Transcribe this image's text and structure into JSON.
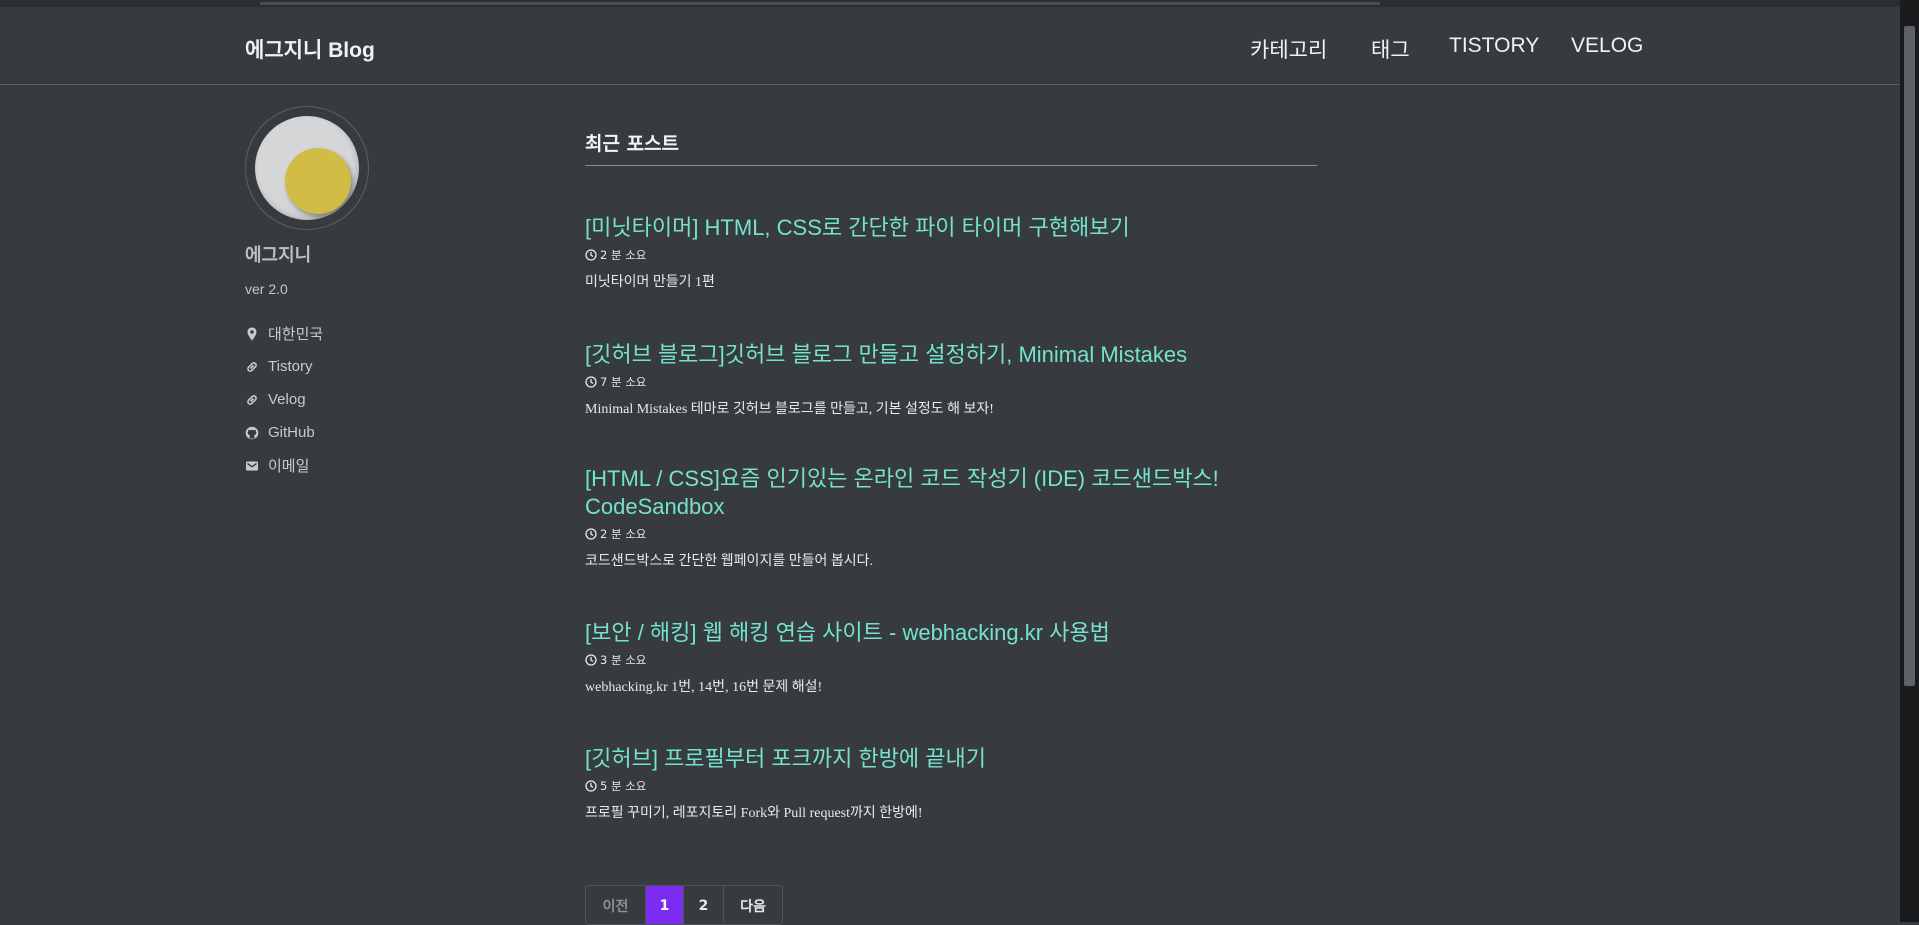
{
  "site": {
    "title": "에그지니 Blog"
  },
  "nav": [
    {
      "label": "카테고리"
    },
    {
      "label": "태그"
    },
    {
      "label": "TISTORY"
    },
    {
      "label": "VELOG"
    }
  ],
  "author": {
    "name": "에그지니",
    "bio": "ver 2.0",
    "links": [
      {
        "label": "대한민국",
        "icon": "map-marker-icon"
      },
      {
        "label": "Tistory",
        "icon": "link-icon"
      },
      {
        "label": "Velog",
        "icon": "link-icon"
      },
      {
        "label": "GitHub",
        "icon": "github-icon"
      },
      {
        "label": "이메일",
        "icon": "envelope-icon"
      }
    ]
  },
  "main": {
    "title": "최근 포스트",
    "posts": [
      {
        "title": "[미닛타이머] HTML, CSS로 간단한 파이 타이머 구현해보기",
        "read_time": "2 분 소요",
        "excerpt": "미닛타이머 만들기 1편"
      },
      {
        "title": "[깃허브 블로그]깃허브 블로그 만들고 설정하기, Minimal Mistakes",
        "read_time": "7 분 소요",
        "excerpt": "Minimal Mistakes 테마로 깃허브 블로그를 만들고, 기본 설정도 해 보자!"
      },
      {
        "title": "[HTML / CSS]요즘 인기있는 온라인 코드 작성기 (IDE) 코드샌드박스! CodeSandbox",
        "read_time": "2 분 소요",
        "excerpt": "코드샌드박스로 간단한 웹페이지를 만들어 봅시다."
      },
      {
        "title": "[보안 / 해킹] 웹 해킹 연습 사이트 - webhacking.kr 사용법",
        "read_time": "3 분 소요",
        "excerpt": "webhacking.kr 1번, 14번, 16번 문제 해설!"
      },
      {
        "title": "[깃허브] 프로필부터 포크까지 한방에 끝내기",
        "read_time": "5 분 소요",
        "excerpt": "프로필 꾸미기, 레포지토리 Fork와 Pull request까지 한방에!"
      }
    ]
  },
  "pagination": {
    "prev": "이전",
    "pages": [
      "1",
      "2"
    ],
    "current": "1",
    "next": "다음"
  },
  "colors": {
    "background": "#373b3f",
    "post_link": "#74e3c9",
    "active_page": "#7b2cf0",
    "avatar_moon": "#d1bd45"
  }
}
